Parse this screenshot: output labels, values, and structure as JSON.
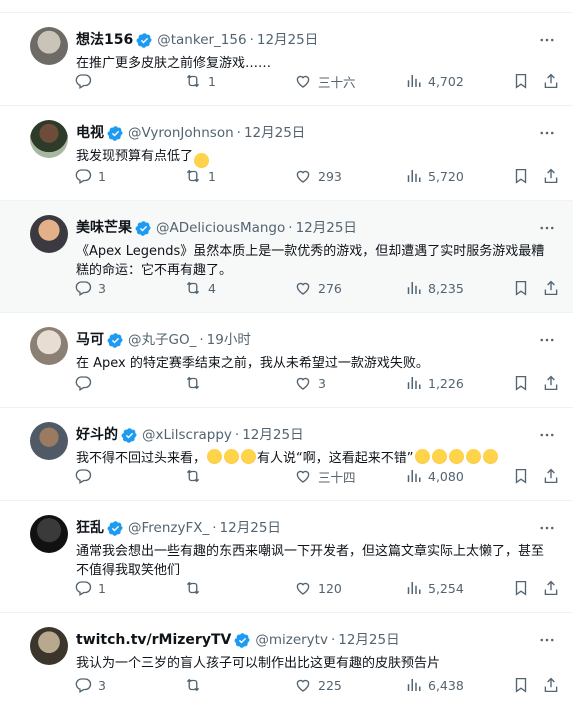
{
  "colors": {
    "verified": "#1d9bf0",
    "muted": "#536471",
    "text": "#0f1419",
    "highlight_bg": "#f7f9f9",
    "divider": "#eff3f4"
  },
  "icons": {
    "verified": "verified-badge-icon",
    "more": "more-options-icon",
    "reply": "reply-icon",
    "retweet": "retweet-icon",
    "like": "heart-icon",
    "views": "views-bar-chart-icon",
    "bookmark": "bookmark-icon",
    "share": "share-icon"
  },
  "tweets": [
    {
      "name": "想法156",
      "handle": "@tanker_156",
      "dot": "·",
      "time": "12月25日",
      "text": "在推广更多皮肤之前修复游戏……",
      "replies": "",
      "retweets": "1",
      "likes": "三十六",
      "views": "4,702"
    },
    {
      "name": "电视",
      "handle": "@VyronJohnson",
      "dot": "·",
      "time": "12月25日",
      "text": "我发现预算有点低了",
      "emoji_after": "😭",
      "replies": "1",
      "retweets": "1",
      "likes": "293",
      "views": "5,720"
    },
    {
      "name": "美味芒果",
      "handle": "@ADeliciousMango",
      "dot": "·",
      "time": "12月25日",
      "text": "《Apex Legends》虽然本质上是一款优秀的游戏，但却遭遇了实时服务游戏最糟糕的命运：它不再有趣了。",
      "replies": "3",
      "retweets": "4",
      "likes": "276",
      "views": "8,235"
    },
    {
      "name": "马可",
      "handle": "@丸子GO_",
      "dot": "·",
      "time": "19小时",
      "text": "在 Apex 的特定赛季结束之前，我从未希望过一款游戏失败。",
      "replies": "",
      "retweets": "",
      "likes": "3",
      "views": "1,226"
    },
    {
      "name": "好斗的",
      "handle": "@xLilscrappy",
      "dot": "·",
      "time": "12月25日",
      "text_a": "我不得不回过头来看，",
      "text_b": "有人说“啊，这看起来不错”",
      "replies": "",
      "retweets": "",
      "likes": "三十四",
      "views": "4,080"
    },
    {
      "name": "狂乱",
      "handle": "@FrenzyFX_",
      "dot": "·",
      "time": "12月25日",
      "text": "通常我会想出一些有趣的东西来嘲讽一下开发者，但这篇文章实际上太懒了，甚至不值得我取笑他们",
      "replies": "1",
      "retweets": "",
      "likes": "120",
      "views": "5,254"
    },
    {
      "name": "twitch.tv/rMizeryTV",
      "handle": "@mizerytv",
      "dot": "·",
      "time": "12月25日",
      "text": "我认为一个三岁的盲人孩子可以制作出比这更有趣的皮肤预告片",
      "replies": "3",
      "retweets": "",
      "likes": "225",
      "views": "6,438"
    }
  ]
}
